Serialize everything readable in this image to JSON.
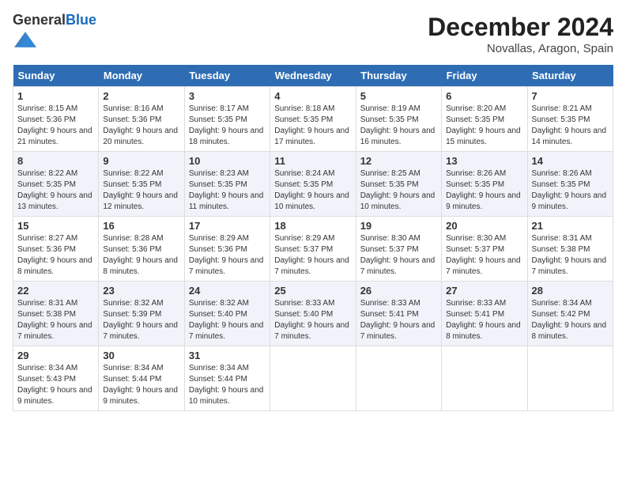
{
  "header": {
    "logo_general": "General",
    "logo_blue": "Blue",
    "month_title": "December 2024",
    "location": "Novallas, Aragon, Spain"
  },
  "weekdays": [
    "Sunday",
    "Monday",
    "Tuesday",
    "Wednesday",
    "Thursday",
    "Friday",
    "Saturday"
  ],
  "weeks": [
    [
      {
        "day": "1",
        "sunrise": "8:15 AM",
        "sunset": "5:36 PM",
        "daylight": "9 hours and 21 minutes."
      },
      {
        "day": "2",
        "sunrise": "8:16 AM",
        "sunset": "5:36 PM",
        "daylight": "9 hours and 20 minutes."
      },
      {
        "day": "3",
        "sunrise": "8:17 AM",
        "sunset": "5:35 PM",
        "daylight": "9 hours and 18 minutes."
      },
      {
        "day": "4",
        "sunrise": "8:18 AM",
        "sunset": "5:35 PM",
        "daylight": "9 hours and 17 minutes."
      },
      {
        "day": "5",
        "sunrise": "8:19 AM",
        "sunset": "5:35 PM",
        "daylight": "9 hours and 16 minutes."
      },
      {
        "day": "6",
        "sunrise": "8:20 AM",
        "sunset": "5:35 PM",
        "daylight": "9 hours and 15 minutes."
      },
      {
        "day": "7",
        "sunrise": "8:21 AM",
        "sunset": "5:35 PM",
        "daylight": "9 hours and 14 minutes."
      }
    ],
    [
      {
        "day": "8",
        "sunrise": "8:22 AM",
        "sunset": "5:35 PM",
        "daylight": "9 hours and 13 minutes."
      },
      {
        "day": "9",
        "sunrise": "8:22 AM",
        "sunset": "5:35 PM",
        "daylight": "9 hours and 12 minutes."
      },
      {
        "day": "10",
        "sunrise": "8:23 AM",
        "sunset": "5:35 PM",
        "daylight": "9 hours and 11 minutes."
      },
      {
        "day": "11",
        "sunrise": "8:24 AM",
        "sunset": "5:35 PM",
        "daylight": "9 hours and 10 minutes."
      },
      {
        "day": "12",
        "sunrise": "8:25 AM",
        "sunset": "5:35 PM",
        "daylight": "9 hours and 10 minutes."
      },
      {
        "day": "13",
        "sunrise": "8:26 AM",
        "sunset": "5:35 PM",
        "daylight": "9 hours and 9 minutes."
      },
      {
        "day": "14",
        "sunrise": "8:26 AM",
        "sunset": "5:35 PM",
        "daylight": "9 hours and 9 minutes."
      }
    ],
    [
      {
        "day": "15",
        "sunrise": "8:27 AM",
        "sunset": "5:36 PM",
        "daylight": "9 hours and 8 minutes."
      },
      {
        "day": "16",
        "sunrise": "8:28 AM",
        "sunset": "5:36 PM",
        "daylight": "9 hours and 8 minutes."
      },
      {
        "day": "17",
        "sunrise": "8:29 AM",
        "sunset": "5:36 PM",
        "daylight": "9 hours and 7 minutes."
      },
      {
        "day": "18",
        "sunrise": "8:29 AM",
        "sunset": "5:37 PM",
        "daylight": "9 hours and 7 minutes."
      },
      {
        "day": "19",
        "sunrise": "8:30 AM",
        "sunset": "5:37 PM",
        "daylight": "9 hours and 7 minutes."
      },
      {
        "day": "20",
        "sunrise": "8:30 AM",
        "sunset": "5:37 PM",
        "daylight": "9 hours and 7 minutes."
      },
      {
        "day": "21",
        "sunrise": "8:31 AM",
        "sunset": "5:38 PM",
        "daylight": "9 hours and 7 minutes."
      }
    ],
    [
      {
        "day": "22",
        "sunrise": "8:31 AM",
        "sunset": "5:38 PM",
        "daylight": "9 hours and 7 minutes."
      },
      {
        "day": "23",
        "sunrise": "8:32 AM",
        "sunset": "5:39 PM",
        "daylight": "9 hours and 7 minutes."
      },
      {
        "day": "24",
        "sunrise": "8:32 AM",
        "sunset": "5:40 PM",
        "daylight": "9 hours and 7 minutes."
      },
      {
        "day": "25",
        "sunrise": "8:33 AM",
        "sunset": "5:40 PM",
        "daylight": "9 hours and 7 minutes."
      },
      {
        "day": "26",
        "sunrise": "8:33 AM",
        "sunset": "5:41 PM",
        "daylight": "9 hours and 7 minutes."
      },
      {
        "day": "27",
        "sunrise": "8:33 AM",
        "sunset": "5:41 PM",
        "daylight": "9 hours and 8 minutes."
      },
      {
        "day": "28",
        "sunrise": "8:34 AM",
        "sunset": "5:42 PM",
        "daylight": "9 hours and 8 minutes."
      }
    ],
    [
      {
        "day": "29",
        "sunrise": "8:34 AM",
        "sunset": "5:43 PM",
        "daylight": "9 hours and 9 minutes."
      },
      {
        "day": "30",
        "sunrise": "8:34 AM",
        "sunset": "5:44 PM",
        "daylight": "9 hours and 9 minutes."
      },
      {
        "day": "31",
        "sunrise": "8:34 AM",
        "sunset": "5:44 PM",
        "daylight": "9 hours and 10 minutes."
      },
      null,
      null,
      null,
      null
    ]
  ],
  "labels": {
    "sunrise": "Sunrise:",
    "sunset": "Sunset:",
    "daylight": "Daylight:"
  }
}
